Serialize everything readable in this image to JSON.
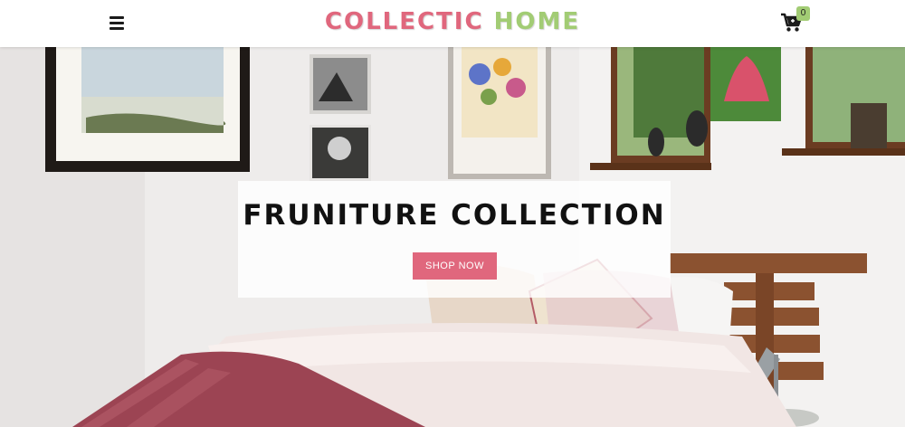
{
  "header": {
    "menu_icon": "hamburger-menu-icon",
    "logo_part1": "COLLECTIC",
    "logo_part2": "HOME",
    "cart_icon": "shopping-cart-icon",
    "cart_count": "0"
  },
  "hero": {
    "title": "FRUNITURE COLLECTION",
    "button_label": "SHOP NOW"
  },
  "colors": {
    "accent_pink": "#e0677d",
    "accent_green": "#a2cc74",
    "text_dark": "#111111"
  }
}
